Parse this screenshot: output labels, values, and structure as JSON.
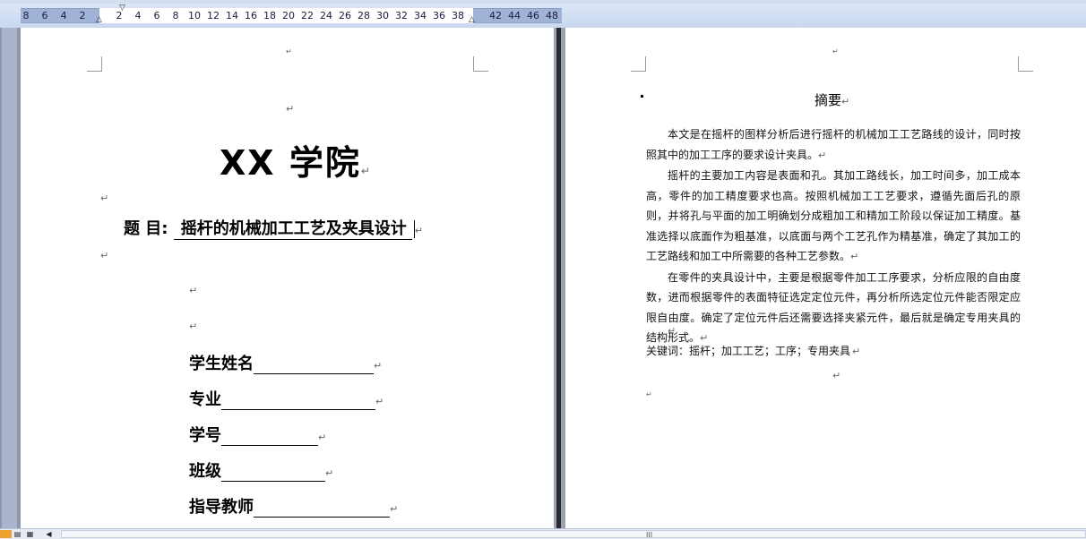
{
  "ruler": {
    "numbers": [
      "8",
      "6",
      "4",
      "2",
      "2",
      "4",
      "6",
      "8",
      "10",
      "12",
      "14",
      "16",
      "18",
      "20",
      "22",
      "24",
      "26",
      "28",
      "30",
      "32",
      "34",
      "36",
      "38",
      "42",
      "44",
      "46",
      "48"
    ]
  },
  "page1": {
    "school": "XX 学院",
    "topic_label": "题  目:",
    "topic_value": "摇杆的机械加工工艺及夹具设计",
    "fields": [
      {
        "label": "学生姓名"
      },
      {
        "label": "专业"
      },
      {
        "label": "学号"
      },
      {
        "label": "班级"
      },
      {
        "label": "指导教师"
      }
    ],
    "para_mark": "↵"
  },
  "page2": {
    "title": "摘要",
    "paragraphs": [
      "本文是在摇杆的图样分析后进行摇杆的机械加工工艺路线的设计，同时按照其中的加工工序的要求设计夹具。",
      "摇杆的主要加工内容是表面和孔。其加工路线长，加工时间多，加工成本高，零件的加工精度要求也高。按照机械加工工艺要求，遵循先面后孔的原则，并将孔与平面的加工明确划分成粗加工和精加工阶段以保证加工精度。基准选择以底面作为粗基准，以底面与两个工艺孔作为精基准，确定了其加工的工艺路线和加工中所需要的各种工艺参数。",
      "在零件的夹具设计中，主要是根据零件加工工序要求，分析应限的自由度数，进而根据零件的表面特征选定定位元件，再分析所选定位元件能否限定应限自由度。确定了定位元件后还需要选择夹紧元件，最后就是确定专用夹具的结构形式。"
    ],
    "keywords": "关键词：摇杆；加工工艺；工序；专用夹具"
  },
  "bottombar": {
    "thumb_glyph": "III"
  }
}
